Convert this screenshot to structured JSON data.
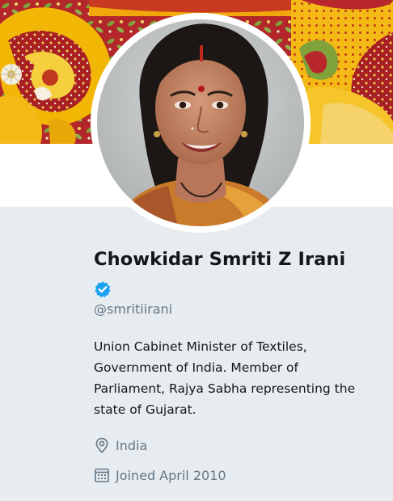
{
  "profile": {
    "display_name": "Chowkidar Smriti Z Irani",
    "verified": true,
    "handle": "@smritiirani",
    "bio_lines": [
      "Union Cabinet Minister of Textiles,",
      "Government of India. Member of",
      "Parliament, Rajya Sabha representing the",
      "state of Gujarat."
    ],
    "location": "India",
    "joined": "Joined April 2010"
  },
  "icons": {
    "verified": "verified-badge-icon",
    "location": "location-pin-icon",
    "joined": "calendar-icon"
  },
  "colors": {
    "verified_badge": "#1da1f2",
    "page_background": "#e6ecf0",
    "secondary_text": "#657786",
    "primary_text": "#14171a",
    "banner_yellow": "#f2b705",
    "banner_red": "#b5262a"
  }
}
